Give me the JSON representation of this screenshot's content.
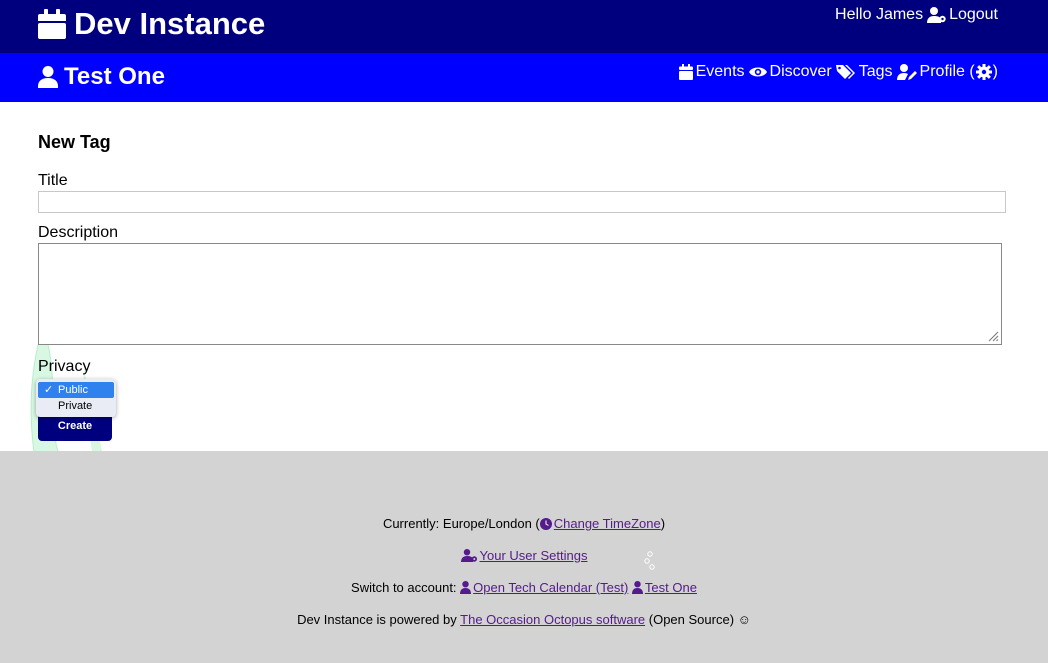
{
  "header": {
    "site_title": "Dev Instance",
    "greeting": "Hello James",
    "logout_label": "Logout"
  },
  "account_bar": {
    "account_name": "Test One",
    "nav": {
      "events": "Events",
      "discover": "Discover",
      "tags": "Tags",
      "profile": "Profile (",
      "profile_close": ")"
    }
  },
  "form": {
    "heading": "New Tag",
    "title_label": "Title",
    "title_value": "",
    "description_label": "Description",
    "description_value": "",
    "privacy_label": "Privacy",
    "privacy_options": [
      "Public",
      "Private"
    ],
    "privacy_selected": "Public",
    "submit_label": "Create"
  },
  "footer": {
    "timezone_prefix": "Currently: Europe/London (",
    "change_timezone": "Change TimeZone",
    "timezone_suffix": ")",
    "user_settings": "Your User Settings",
    "switch_prefix": "Switch to account:",
    "account_open_tech": "Open Tech Calendar (Test)",
    "account_test_one": "Test One",
    "powered_prefix": "Dev Instance is powered by",
    "software_link": "The Occasion Octopus software",
    "powered_suffix": "(Open Source) ☺"
  },
  "colors": {
    "header_bg": "#00007f",
    "account_bar_bg": "#0000ff",
    "footer_bg": "#d3d3d3",
    "link": "#551a8b",
    "selected_option": "#2f82ee"
  }
}
